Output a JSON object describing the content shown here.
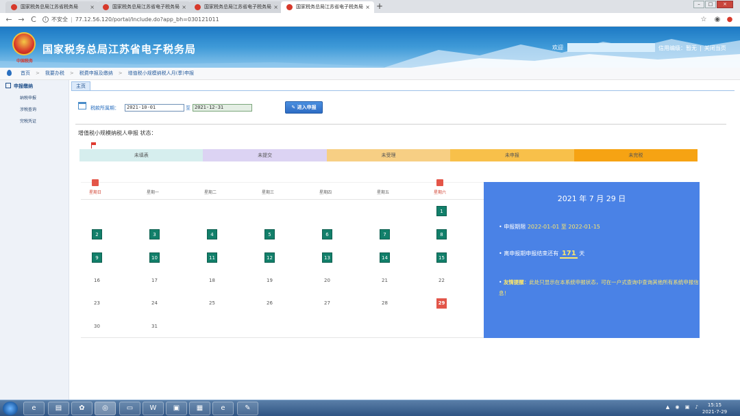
{
  "browser": {
    "tabs": [
      {
        "title": "国家税务总局江苏省税务局"
      },
      {
        "title": "国家税务总局江苏省电子税务局"
      },
      {
        "title": "国家税务总局江苏省电子税务局"
      },
      {
        "title": "国家税务总局江苏省电子税务局"
      }
    ],
    "new_tab_label": "+",
    "close_glyph": "×",
    "security_label": "不安全",
    "url": "77.12.56.120/portal/Include.do?app_bh=030121011"
  },
  "header": {
    "site_title": "国家税务总局江苏省电子税务局",
    "emblem_caption": "中国税务",
    "welcome_label": "欢迎",
    "credit_text": "信用编级：暂无",
    "close_link": "关闭当页"
  },
  "breadcrumb": {
    "items": [
      "首页",
      "我要办税",
      "税费申报及缴纳",
      "增值税小规模纳税人月(季)申报"
    ]
  },
  "sidebar": {
    "title": "申报缴纳",
    "items": [
      {
        "label": "纳税申报"
      },
      {
        "label": "涉税查询"
      },
      {
        "label": "完税凭证"
      }
    ]
  },
  "main": {
    "tab_label": "主页",
    "period": {
      "label": "税款所属期：",
      "start": "2021-10-01",
      "to_label": "至",
      "end": "2021-12-31"
    },
    "enter_button": "进入申报",
    "status_title": "增值税小规模纳税人申报 状态：",
    "steps": [
      {
        "label": "未填表",
        "color": "#d6eeee"
      },
      {
        "label": "未提交",
        "color": "#dcd3f3"
      },
      {
        "label": "未受理",
        "color": "#f7cf84"
      },
      {
        "label": "未申报",
        "color": "#f8c04a"
      },
      {
        "label": "未完税",
        "color": "#f6a313"
      }
    ]
  },
  "calendar": {
    "weekdays": [
      "星期日",
      "星期一",
      "星期二",
      "星期三",
      "星期四",
      "星期五",
      "星期六"
    ],
    "first_weekday": 6,
    "days_in_month": 31,
    "deadline_days": [
      1,
      2,
      3,
      4,
      5,
      6,
      7,
      8,
      9,
      10,
      11,
      12,
      13,
      14,
      15
    ],
    "today": 29
  },
  "info": {
    "date_title": "2021 年 7 月 29 日",
    "period_label": "申报期限",
    "period_value": "2022-01-01 至 2022-01-15",
    "remain_prefix": "离申报期申报结束还有",
    "remain_days": "171",
    "remain_suffix": "天",
    "reminder_label": "友情提醒",
    "reminder_text": "：此处只显示在本系统申报状态，可在一户式查询中查询其他所有系统申报信息！"
  },
  "taskbar": {
    "time": "15:15",
    "date": "2021-7-29"
  }
}
